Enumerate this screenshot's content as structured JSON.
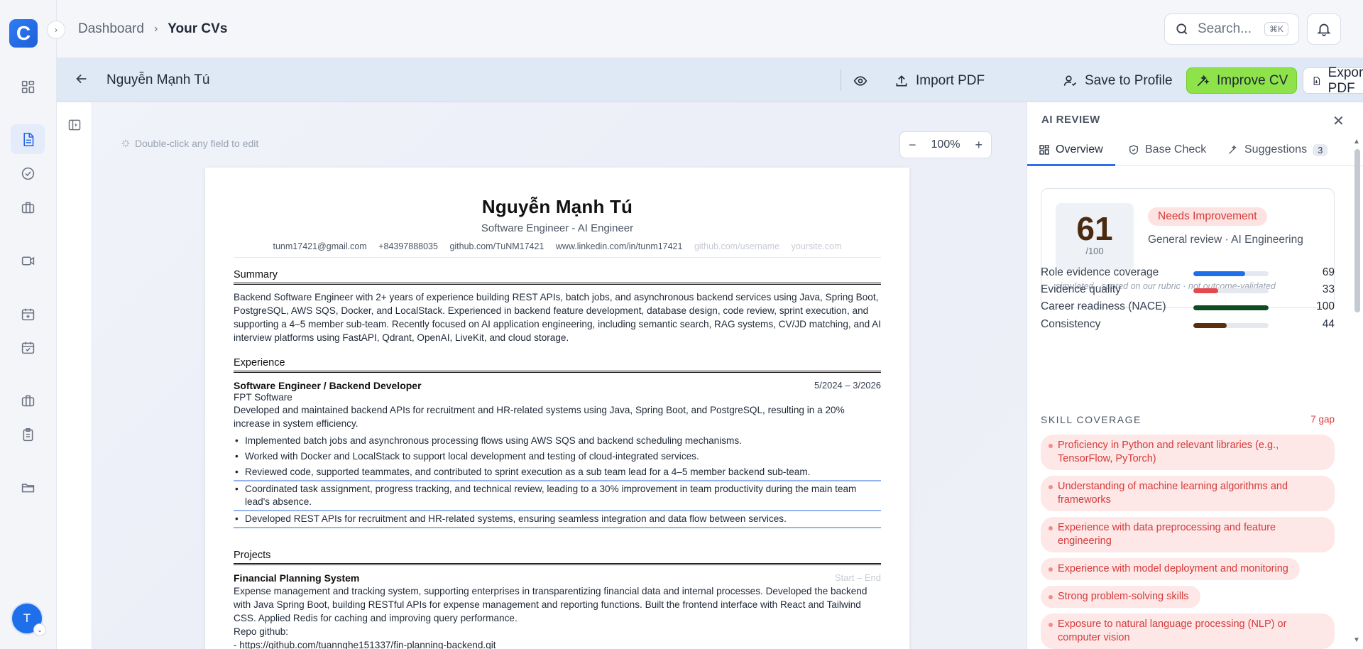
{
  "app": {
    "logo_letter": "C"
  },
  "breadcrumb": {
    "parent": "Dashboard",
    "current": "Your CVs"
  },
  "search": {
    "placeholder": "Search...",
    "shortcut": "⌘K"
  },
  "user": {
    "initial": "T"
  },
  "toolbar": {
    "cv_name": "Nguyễn Mạnh Tú",
    "import_pdf": "Import PDF",
    "save_profile": "Save to Profile",
    "improve_cv": "Improve CV",
    "export_pdf": "Export PDF"
  },
  "editor": {
    "hint": "Double-click any field to edit",
    "zoom": "100%"
  },
  "cv": {
    "name": "Nguyễn Mạnh Tú",
    "title": "Software Engineer - AI Engineer",
    "contacts": [
      "tunm17421@gmail.com",
      "+84397888035",
      "github.com/TuNM17421",
      "www.linkedin.com/in/tunm17421"
    ],
    "contact_placeholders": [
      "github.com/username",
      "yoursite.com"
    ],
    "summary_title": "Summary",
    "summary": "Backend Software Engineer with 2+ years of experience building REST APIs, batch jobs, and asynchronous backend services using Java, Spring Boot, PostgreSQL, AWS SQS, Docker, and LocalStack. Experienced in backend feature development, database design, code review, sprint execution, and supporting a 4–5 member sub-team. Recently focused on AI application engineering, including semantic search, RAG systems, CV/JD matching, and AI interview platforms using FastAPI, Qdrant, OpenAI, LiveKit, and cloud storage.",
    "experience_title": "Experience",
    "job": {
      "role": "Software Engineer / Backend Developer",
      "dates": "5/2024 – 3/2026",
      "company": "FPT Software",
      "description": "Developed and maintained backend APIs for recruitment and HR-related systems using Java, Spring Boot, and PostgreSQL, resulting in a 20% increase in system efficiency.",
      "bullets": [
        "Implemented batch jobs and asynchronous processing flows using AWS SQS and backend scheduling mechanisms.",
        "Worked with Docker and LocalStack to support local development and testing of cloud-integrated services.",
        "Reviewed code, supported teammates, and contributed to sprint execution as a sub team lead for a 4–5 member backend sub-team.",
        "Coordinated task assignment, progress tracking, and technical review, leading to a 30% improvement in team productivity during the main team lead's absence.",
        "Developed REST APIs for recruitment and HR-related systems, ensuring seamless integration and data flow between services."
      ]
    },
    "projects_title": "Projects",
    "project": {
      "name": "Financial Planning System",
      "dates": "Start – End",
      "description": "Expense management and tracking system, supporting enterprises in transparentizing financial data and internal processes. Developed the backend with Java Spring Boot, building RESTful APIs for expense management and reporting functions. Built the frontend interface with React and Tailwind CSS. Applied Redis for caching and improving query performance.",
      "repo_label": "Repo github:",
      "repo_url": "- https://github.com/tuannghe151337/fin-planning-backend.git"
    }
  },
  "ai_review": {
    "title": "AI REVIEW",
    "tabs": [
      {
        "label": "Overview"
      },
      {
        "label": "Base Check"
      },
      {
        "label": "Suggestions",
        "badge": "3"
      }
    ],
    "score": "61",
    "score_max": "/100",
    "status": "Needs Improvement",
    "review_type": "General review · AI Engineering",
    "note": "simulated · scored on our rubric · not outcome-validated",
    "metrics": [
      {
        "label": "Role evidence coverage",
        "value": "69",
        "pct": 69,
        "color": "#1f6feb"
      },
      {
        "label": "Evidence quality",
        "value": "33",
        "pct": 33,
        "color": "#e5484d"
      },
      {
        "label": "Career readiness (NACE)",
        "value": "100",
        "pct": 100,
        "color": "#0d4d1f"
      },
      {
        "label": "Consistency",
        "value": "44",
        "pct": 44,
        "color": "#5a2e0e"
      }
    ],
    "skill_coverage_title": "SKILL COVERAGE",
    "skill_gap": "7 gap",
    "skills": [
      "Proficiency in Python and relevant libraries (e.g., TensorFlow, PyTorch)",
      "Understanding of machine learning algorithms and frameworks",
      "Experience with data preprocessing and feature engineering",
      "Experience with model deployment and monitoring",
      "Strong problem-solving skills",
      "Exposure to natural language processing (NLP) or computer vision"
    ]
  }
}
